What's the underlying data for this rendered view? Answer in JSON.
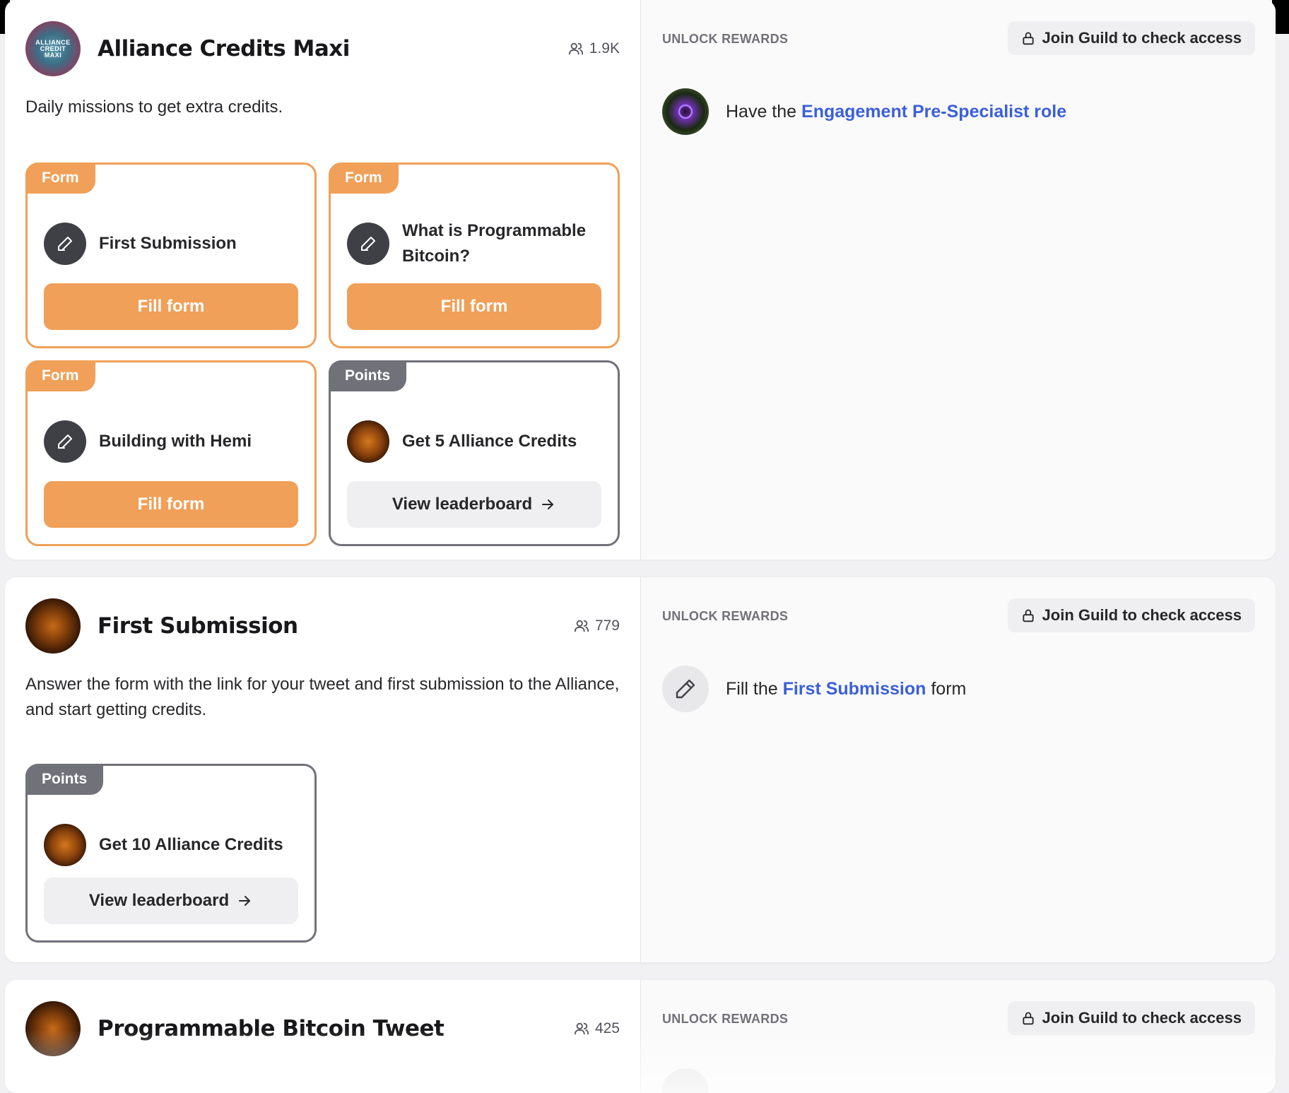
{
  "roles": [
    {
      "title": "Alliance Credits Maxi",
      "avatar_text": [
        "ALLIANCE",
        "CREDIT",
        "MAXI"
      ],
      "members": "1.9K",
      "description": "Daily missions to get extra credits.",
      "rewards": [
        {
          "tag": "Form",
          "name": "First Submission",
          "button": "Fill form"
        },
        {
          "tag": "Form",
          "name": "What is Programmable Bitcoin?",
          "button": "Fill form"
        },
        {
          "tag": "Form",
          "name": "Building with Hemi",
          "button": "Fill form"
        },
        {
          "tag": "Points",
          "name": "Get 5 Alliance Credits",
          "button": "View leaderboard"
        }
      ],
      "unlock_label": "UNLOCK REWARDS",
      "join_label": "Join Guild to check access",
      "requirement": {
        "prefix": "Have the ",
        "link": "Engagement Pre-Specialist role",
        "suffix": ""
      }
    },
    {
      "title": "First Submission",
      "members": "779",
      "description": "Answer the form with the link for your tweet and first submission to the Alliance, and start getting credits.",
      "rewards": [
        {
          "tag": "Points",
          "name": "Get 10 Alliance Credits",
          "button": "View leaderboard"
        }
      ],
      "unlock_label": "UNLOCK REWARDS",
      "join_label": "Join Guild to check access",
      "requirement": {
        "prefix": "Fill the ",
        "link": "First Submission",
        "suffix": " form"
      }
    },
    {
      "title": "Programmable Bitcoin Tweet",
      "members": "425",
      "unlock_label": "UNLOCK REWARDS",
      "join_label": "Join Guild to check access"
    }
  ],
  "icons": {
    "members": "users-icon",
    "form": "pencil-icon",
    "lock": "lock-icon",
    "arrow": "arrow-right-icon"
  },
  "colors": {
    "form_accent": "#f0a058",
    "points_accent": "#71717a",
    "link": "#3b5fd9"
  }
}
